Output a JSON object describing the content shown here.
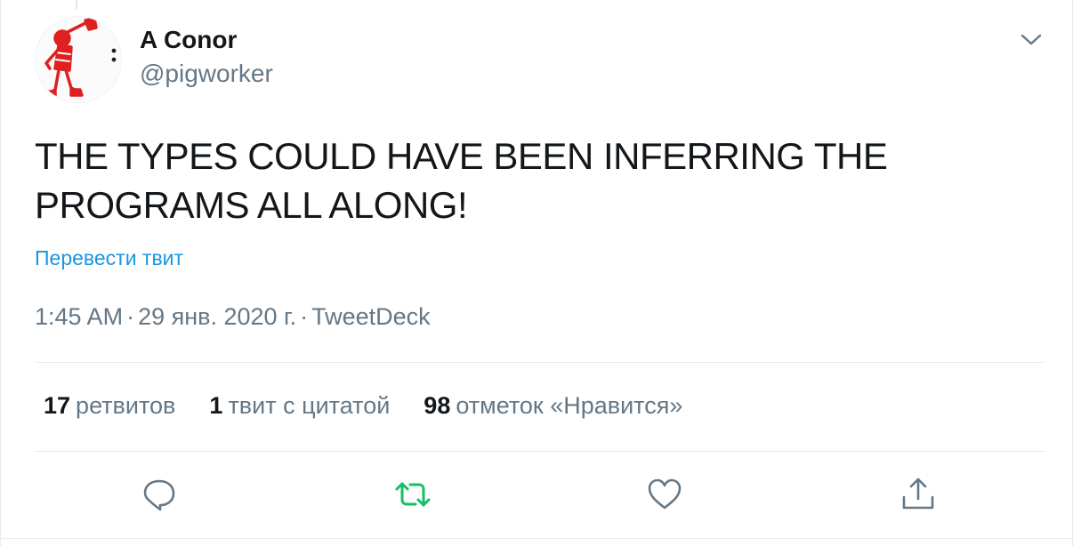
{
  "tweet": {
    "author": {
      "name": "A Conor",
      "handle": "@pigworker",
      "avatar_icon": "pig-worker-avatar",
      "avatar_color": "#e02020"
    },
    "text": "THE TYPES COULD HAVE BEEN INFERRING THE PROGRAMS ALL ALONG!",
    "translate_label": "Перевести твит",
    "time": "1:45 AM",
    "separator": "·",
    "date": "29 янв. 2020 г.",
    "source": "TweetDeck",
    "stats": {
      "retweets_count": "17",
      "retweets_label": "ретвитов",
      "quotes_count": "1",
      "quotes_label": "твит с цитатой",
      "likes_count": "98",
      "likes_label": "отметок «Нравится»"
    },
    "actions": {
      "reply_icon": "reply-icon",
      "retweet_icon": "retweet-icon",
      "like_icon": "heart-icon",
      "share_icon": "share-icon"
    },
    "colors": {
      "link": "#1b95e0",
      "retweet_active": "#17bf63",
      "secondary_text": "#657786",
      "icon_gray": "#657786"
    }
  }
}
